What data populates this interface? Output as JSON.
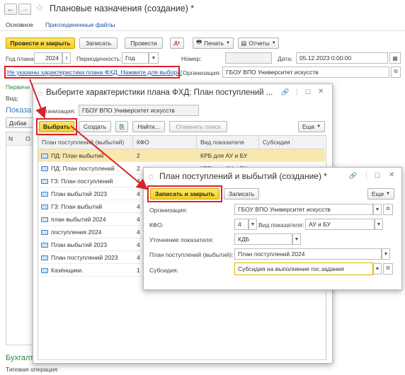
{
  "main": {
    "title": "Плановые назначения (создание) *",
    "nav_back": "←",
    "nav_forward": "→",
    "tabs": [
      "Основное",
      "Присоединенные файлы"
    ],
    "toolbar": {
      "post_close": "Провести и закрыть",
      "save": "Записать",
      "post": "Провести",
      "print": "Печать",
      "reports": "Отчеты"
    },
    "year_label": "Год плана:",
    "year_value": "2024",
    "period_label": "Периодичность:",
    "period_value": "Год",
    "number_label": "Номер:",
    "number_value": "",
    "date_label": "Дата:",
    "date_value": "05.12.2023  0:00:00",
    "link_text": "Не указаны характеристики плана ФХД. Нажмите для выбора!",
    "org_label": "Организация:",
    "org_value": "ГБОУ ВПО Университет искусств",
    "primary_label": "Первичн",
    "vid_label": "Вид:",
    "indicators_label": "Показа",
    "add_label": "Добав",
    "col_n": "N",
    "col_o": "О",
    "accounting_label": "Бухгалт",
    "op_type_label": "Типовая операция:"
  },
  "select_dialog": {
    "title": "Выберите характеристики плана ФХД: План поступлений ...",
    "org_label": "Организация:",
    "org_value": "ГБОУ ВПО Университет искусств",
    "buttons": {
      "choose": "Выбрать",
      "create": "Создать",
      "find": "Найти...",
      "cancel_search": "Отменить поиск",
      "more": "Еще"
    },
    "columns": [
      "План поступлений (выбытий)",
      "КФО",
      "Вид показателя",
      "Субсидия"
    ],
    "rows": [
      {
        "name": "ПД: План выбытий",
        "kfo": "2",
        "vid": "КРБ для АУ и БУ",
        "sub": ""
      },
      {
        "name": "ПД: План поступлений",
        "kfo": "2",
        "vid": "КРБ для АУ и БУ",
        "sub": ""
      },
      {
        "name": "ГЗ: План поступлений",
        "kfo": "4",
        "vid": "",
        "sub": ""
      },
      {
        "name": "План выбытий 2023",
        "kfo": "4",
        "vid": "",
        "sub": ""
      },
      {
        "name": "ГЗ: План выбытий",
        "kfo": "4",
        "vid": "",
        "sub": ""
      },
      {
        "name": "план выбытий 2024",
        "kfo": "4",
        "vid": "",
        "sub": ""
      },
      {
        "name": "поступления 2024",
        "kfo": "4",
        "vid": "",
        "sub": ""
      },
      {
        "name": "План выбытий 2023",
        "kfo": "4",
        "vid": "",
        "sub": ""
      },
      {
        "name": "План поступлений 2023",
        "kfo": "4",
        "vid": "",
        "sub": ""
      },
      {
        "name": "Казёнщики.",
        "kfo": "1",
        "vid": "",
        "sub": ""
      }
    ]
  },
  "create_dialog": {
    "title": "План поступлений и выбытий (создание) *",
    "buttons": {
      "save_close": "Записать и закрыть",
      "save": "Записать",
      "more": "Еще"
    },
    "org_label": "Организация:",
    "org_value": "ГБОУ ВПО Университет искусств",
    "kfo_label": "КФО:",
    "kfo_value": "4",
    "vid_label": "Вид показателя:",
    "vid_value": "АУ и БУ",
    "refine_label": "Уточнение показателя:",
    "refine_value": "КДБ",
    "plan_label": "План поступлений (выбытий):",
    "plan_value": "План поступлений 2024",
    "subsidy_label": "Субсидия:",
    "subsidy_value": "Субсидия на выполнение гос.задания"
  },
  "colors": {
    "accent_yellow": "#f4cf23",
    "highlight_red": "#d8232a",
    "link_blue": "#1f4fa3",
    "selected_row": "#f9e7b0"
  }
}
